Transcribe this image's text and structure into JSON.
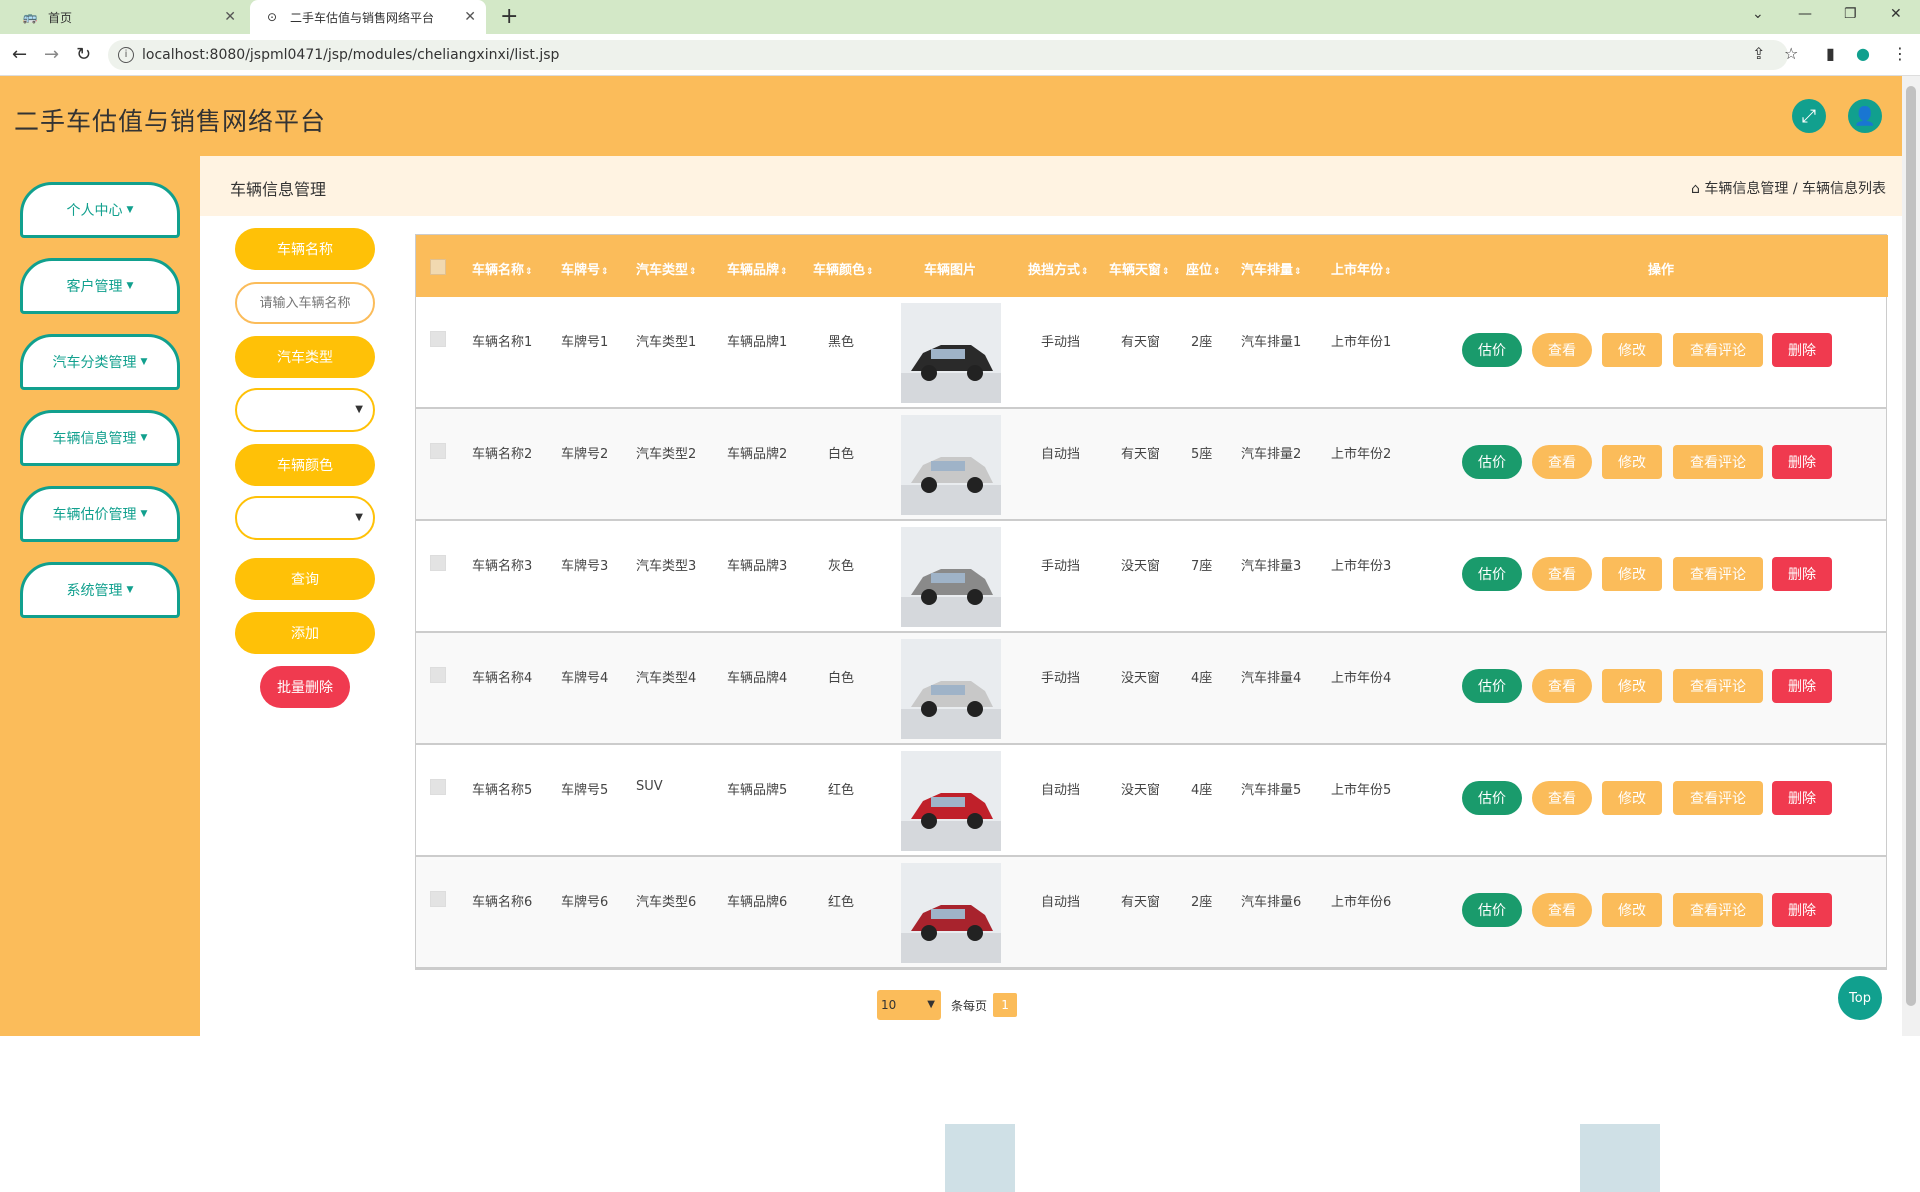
{
  "browser": {
    "tabs": [
      {
        "label": "首页",
        "active": false
      },
      {
        "label": "二手车估值与销售网络平台",
        "active": true
      }
    ],
    "url": "localhost:8080/jspml0471/jsp/modules/cheliangxinxi/list.jsp"
  },
  "header": {
    "title": "二手车估值与销售网络平台"
  },
  "sidebar": {
    "items": [
      {
        "label": "个人中心"
      },
      {
        "label": "客户管理"
      },
      {
        "label": "汽车分类管理"
      },
      {
        "label": "车辆信息管理"
      },
      {
        "label": "车辆估价管理"
      },
      {
        "label": "系统管理"
      }
    ]
  },
  "breadcrumb": {
    "title": "车辆信息管理",
    "path": "车辆信息管理 / 车辆信息列表"
  },
  "filters": {
    "name_label": "车辆名称",
    "name_placeholder": "请输入车辆名称",
    "type_label": "汽车类型",
    "color_label": "车辆颜色",
    "query_label": "查询",
    "add_label": "添加",
    "batch_delete_label": "批量删除"
  },
  "table": {
    "columns": [
      "车辆名称",
      "车牌号",
      "汽车类型",
      "车辆品牌",
      "车辆颜色",
      "车辆图片",
      "换挡方式",
      "车辆天窗",
      "座位",
      "汽车排量",
      "上市年份",
      "操作"
    ],
    "actions": {
      "estimate": "估价",
      "view": "查看",
      "edit": "修改",
      "comments": "查看评论",
      "delete": "删除"
    },
    "rows": [
      {
        "name": "车辆名称1",
        "plate": "车牌号1",
        "type": "汽车类型1",
        "brand": "车辆品牌1",
        "color": "黑色",
        "gear": "手动挡",
        "sunroof": "有天窗",
        "seats": "2座",
        "displacement": "汽车排量1",
        "year": "上市年份1",
        "img_color": "#2a2a2a"
      },
      {
        "name": "车辆名称2",
        "plate": "车牌号2",
        "type": "汽车类型2",
        "brand": "车辆品牌2",
        "color": "白色",
        "gear": "自动挡",
        "sunroof": "有天窗",
        "seats": "5座",
        "displacement": "汽车排量2",
        "year": "上市年份2",
        "img_color": "#c8c8c8"
      },
      {
        "name": "车辆名称3",
        "plate": "车牌号3",
        "type": "汽车类型3",
        "brand": "车辆品牌3",
        "color": "灰色",
        "gear": "手动挡",
        "sunroof": "没天窗",
        "seats": "7座",
        "displacement": "汽车排量3",
        "year": "上市年份3",
        "img_color": "#8a8a8a"
      },
      {
        "name": "车辆名称4",
        "plate": "车牌号4",
        "type": "汽车类型4",
        "brand": "车辆品牌4",
        "color": "白色",
        "gear": "手动挡",
        "sunroof": "没天窗",
        "seats": "4座",
        "displacement": "汽车排量4",
        "year": "上市年份4",
        "img_color": "#c8c8c8"
      },
      {
        "name": "车辆名称5",
        "plate": "车牌号5",
        "type": "SUV",
        "brand": "车辆品牌5",
        "color": "红色",
        "gear": "自动挡",
        "sunroof": "没天窗",
        "seats": "4座",
        "displacement": "汽车排量5",
        "year": "上市年份5",
        "img_color": "#c0202a"
      },
      {
        "name": "车辆名称6",
        "plate": "车牌号6",
        "type": "汽车类型6",
        "brand": "车辆品牌6",
        "color": "红色",
        "gear": "自动挡",
        "sunroof": "有天窗",
        "seats": "2座",
        "displacement": "汽车排量6",
        "year": "上市年份6",
        "img_color": "#a8232d"
      }
    ]
  },
  "pager": {
    "page_size": "10",
    "per_page_label": "条每页",
    "current_page": "1"
  },
  "top_label": "Top"
}
